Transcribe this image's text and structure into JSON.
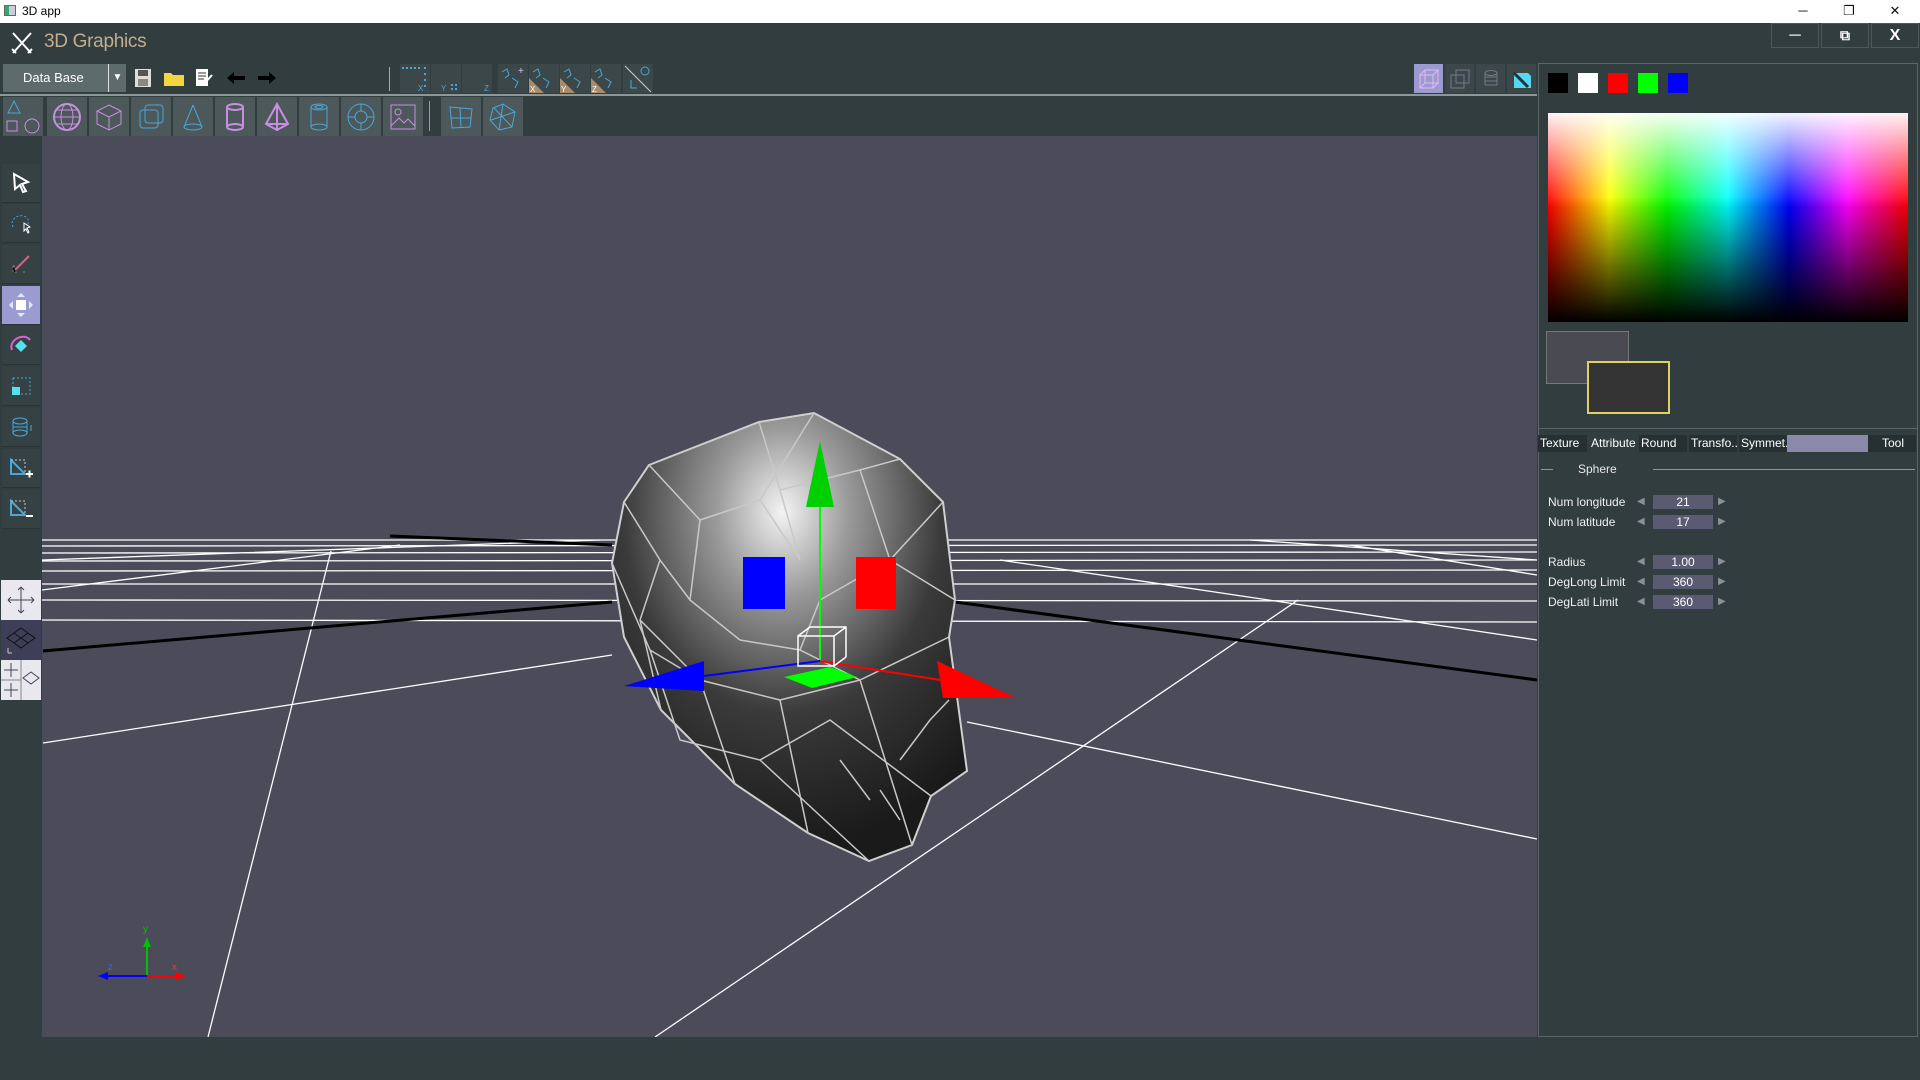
{
  "window": {
    "title": "3D app",
    "controls": [
      "─",
      "❐",
      "✕"
    ]
  },
  "app": {
    "title": "3D Graphics",
    "controls": {
      "minimize": "─",
      "restore": "⧉",
      "close": "X"
    }
  },
  "toolbar": {
    "dropdown_value": "Data Base",
    "grid_labels": [
      "X",
      "Y",
      "Z"
    ],
    "mirror_labels": [
      "X",
      "Y",
      "Z"
    ]
  },
  "palette": {
    "swatches": [
      "#000000",
      "#ffffff",
      "#ff0000",
      "#00ff00",
      "#0000ff"
    ],
    "primary": "#4a4a52",
    "secondary": "#333333",
    "secondary_border": "#e0d060"
  },
  "tabs": [
    {
      "label": "Texture"
    },
    {
      "label": "Attribute"
    },
    {
      "label": "Round"
    },
    {
      "label": "Transfo.."
    },
    {
      "label": "Symmet.."
    },
    {
      "label": ""
    },
    {
      "label": "Tool"
    }
  ],
  "section": {
    "title": "Sphere"
  },
  "params": [
    {
      "label": "Num longitude",
      "value": "21"
    },
    {
      "label": "Num latitude",
      "value": "17"
    },
    {
      "label": "Radius",
      "value": "1.00"
    },
    {
      "label": "DegLong Limit",
      "value": "360"
    },
    {
      "label": "DegLati Limit",
      "value": "360"
    }
  ],
  "axis_indicator": {
    "x": "x",
    "y": "y",
    "z": "z"
  }
}
